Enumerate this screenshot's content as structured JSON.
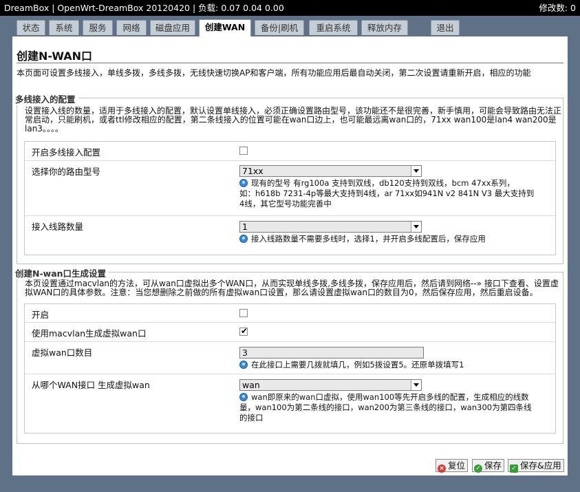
{
  "header": {
    "title": "DreamBox | OpenWrt-DreamBox 20120420 | 负载: 0.07 0.04 0.00",
    "changes": "修改数: 0"
  },
  "tabs": [
    {
      "label": "状态"
    },
    {
      "label": "系统"
    },
    {
      "label": "服务"
    },
    {
      "label": "网络"
    },
    {
      "label": "磁盘应用"
    },
    {
      "label": "创建WAN",
      "active": true
    },
    {
      "label": "备份|刷机"
    },
    {
      "label": "重启系统"
    },
    {
      "label": "释放内存"
    },
    {
      "label": "退出"
    }
  ],
  "page": {
    "title": "创建N-WAN口",
    "description": "本页面可设置多线接入，单线多拨，多线多拨，无线快速切换AP和客户端，所有功能应用后最自动关闭，第二次设置请重新开启，相应的功能"
  },
  "section1": {
    "legend": "多线接入的配置",
    "description": "设置接入线的数量，适用于多线接入的配置，默认设置单线接入，必须正确设置路由型号，该功能还不是很完善，新手慎用，可能会导致路由无法正常启动，只能刷机，或者ttl修改相应的配置，第二条线接入的位置可能在wan口边上，也可能最远离wan口的，71xx wan100是lan4 wan200是lan3。。。。",
    "rows": {
      "enable": {
        "label": "开启多线接入配置",
        "checked": false
      },
      "model": {
        "label": "选择你的路由型号",
        "value": "71xx",
        "hint1": "现有的型号 有rg100a 支持到双线，db120支持到双线，bcm 47xx系列，",
        "hint2": "如：h618b 7231-4p等最大支持到4线，ar 71xx如941N v2 841N V3 最大支持到",
        "hint3": "4线，其它型号功能完善中"
      },
      "count": {
        "label": "接入线路数量",
        "value": "1",
        "hint": "接入线路数量不需要多线时，选择1，并开启多线配置后，保存应用"
      }
    }
  },
  "section2": {
    "legend": "创建N-wan口生成设置",
    "description": "本页设置通过macvlan的方法，可从wan口虚拟出多个WAN口，从而实现单线多拨,多线多拨，保存应用后，然后请到网络--» 接口下查看、设置虚拟WAN口的具体参数。注意：当您想删除之前做的所有虚拟wan口设置，那么请设置虚拟wan口的数目为0，然后保存应用，然后重启设备。",
    "rows": {
      "enable": {
        "label": "开启",
        "checked": false
      },
      "macvlan": {
        "label": "使用macvlan生成虚拟wan口",
        "checked": true
      },
      "vcount": {
        "label": "虚拟wan口数目",
        "value": "3",
        "hint": "在此接口上需要几拨就填几，例如5拨设置5。还原单拨填写1"
      },
      "source": {
        "label": "从哪个WAN接口 生成虚拟wan",
        "value": "wan",
        "hint1": "wan即原来的wan口虚拟，使用wan100等先开启多线的配置，生成相应的线数",
        "hint2": "量，wan100为第二条线的接口，wan200为第三条线的接口，wan300为第四条线",
        "hint3": "的接口"
      }
    }
  },
  "buttons": {
    "reset": "复位",
    "save": "保存",
    "save_apply": "保存&应用"
  }
}
